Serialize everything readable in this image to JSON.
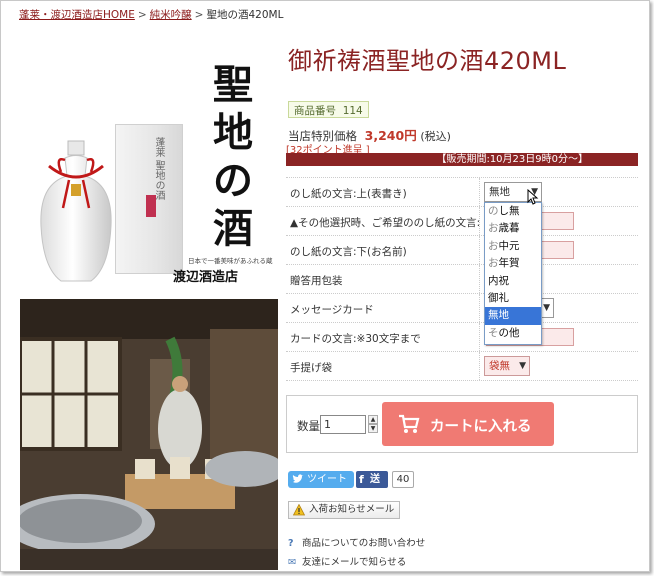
{
  "breadcrumb": {
    "home": "蓬莱・渡辺酒造店HOME",
    "category": "純米吟醸",
    "current": "聖地の酒420ML",
    "separator": ">"
  },
  "product_image": {
    "calligraphy": "聖地の酒",
    "box_label": "蓬莱 聖地の酒",
    "brand_tagline": "日本で一番美味があふれる蔵",
    "brand_logo": "渡辺酒造店"
  },
  "product": {
    "title": "御祈祷酒聖地の酒420ML",
    "item_number_label": "商品番号",
    "item_number": "114",
    "price_label": "当店特別価格",
    "price": "3,240円",
    "tax": "(税込)",
    "points": "[32ポイント進呈 ]",
    "sale_period": "【販売期間:10月23日9時0分～】"
  },
  "options": {
    "rows": [
      {
        "label": "のし紙の文言:上(表書き)",
        "control": "select",
        "value": "無地"
      },
      {
        "label": "▲その他選択時、ご希望ののし紙の文言:",
        "control": "input",
        "value": ""
      },
      {
        "label": "のし紙の文言:下(お名前)",
        "control": "input",
        "value": ""
      },
      {
        "label": "贈答用包装",
        "control": "none",
        "value": ""
      },
      {
        "label": "メッセージカード",
        "control": "select-hidden",
        "value": ""
      },
      {
        "label": "カードの文言:※30文字まで",
        "control": "input",
        "value": ""
      },
      {
        "label": "手提げ袋",
        "control": "select-pink",
        "value": "袋無"
      }
    ],
    "dropdown_items": [
      {
        "prefix": "の",
        "rest": "し無"
      },
      {
        "prefix": "お",
        "rest": "歳暮"
      },
      {
        "prefix": "お",
        "rest": "中元"
      },
      {
        "prefix": "お",
        "rest": "年賀"
      },
      {
        "prefix": "",
        "rest": "内祝"
      },
      {
        "prefix": "",
        "rest": "御礼"
      },
      {
        "prefix": "",
        "rest": "無地"
      },
      {
        "prefix": "そ",
        "rest": "の他"
      }
    ],
    "selected_index": 6
  },
  "cart": {
    "qty_label": "数量",
    "qty_value": "1",
    "add_button": "カートに入れる"
  },
  "social": {
    "tweet": "ツイート",
    "fb_label": "送",
    "fb_count": "40"
  },
  "links": {
    "notify": "入荷お知らせメール",
    "inquiry": "商品についてのお問い合わせ",
    "share_mail": "友達にメールで知らせる"
  },
  "colors": {
    "accent": "#8b2424",
    "cart_button": "#f07a73",
    "selected": "#3875d7",
    "twitter": "#55acee",
    "facebook": "#3b5998"
  }
}
